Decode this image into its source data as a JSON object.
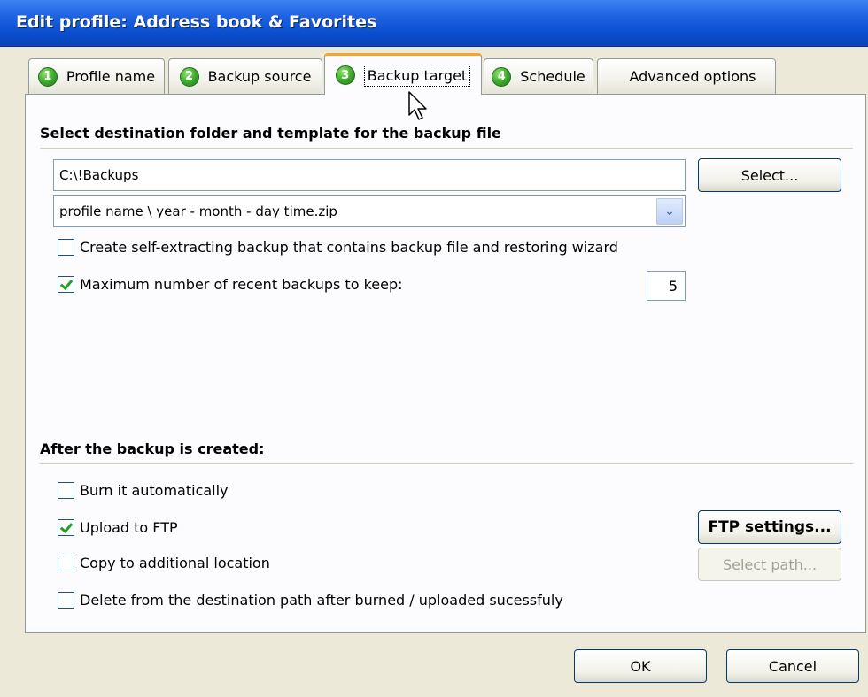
{
  "window": {
    "title": "Edit profile: Address book & Favorites"
  },
  "tabs": [
    {
      "number": "1",
      "label": "Profile name",
      "active": false
    },
    {
      "number": "2",
      "label": "Backup source",
      "active": false
    },
    {
      "number": "3",
      "label": "Backup target",
      "active": true
    },
    {
      "number": "4",
      "label": "Schedule",
      "active": false
    },
    {
      "number": "",
      "label": "Advanced options",
      "active": false
    }
  ],
  "destination": {
    "section_title": "Select destination folder and template for the backup file",
    "folder_value": "C:\\!Backups",
    "select_button": "Select...",
    "template_value": "profile name \\ year - month - day time.zip",
    "self_extracting": {
      "label": "Create self-extracting backup that contains backup file and restoring wizard",
      "checked": false
    },
    "max_backups": {
      "label": "Maximum number of recent backups to keep:",
      "checked": true,
      "value": "5"
    }
  },
  "after": {
    "section_title": "After the backup is created:",
    "burn": {
      "label": "Burn it automatically",
      "checked": false
    },
    "upload_ftp": {
      "label": "Upload to FTP",
      "checked": true
    },
    "copy_location": {
      "label": "Copy to additional location",
      "checked": false
    },
    "delete_after": {
      "label": "Delete from the destination path after burned / uploaded sucessfuly",
      "checked": false
    },
    "ftp_settings_button": "FTP settings...",
    "select_path_button": "Select path..."
  },
  "footer": {
    "ok_button": "OK",
    "cancel_button": "Cancel"
  },
  "icons": {
    "tab_number_badge": "green-circle-number-icon",
    "combo_arrow": "chevron-down-icon",
    "mouse_cursor": "arrow-cursor-icon"
  }
}
